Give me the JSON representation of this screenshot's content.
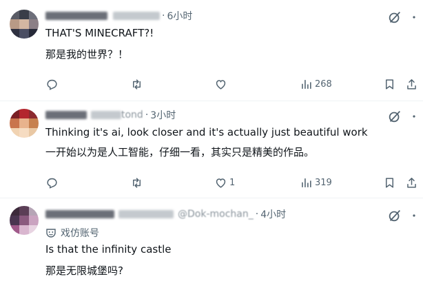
{
  "posts": [
    {
      "time": "6小时",
      "text": "THAT'S MINECRAFT?!",
      "translation": "那是我的世界？！",
      "stats": {
        "replies": "",
        "reposts": "",
        "likes": "",
        "views": "268"
      }
    },
    {
      "handle_visible": "tond",
      "time": "3小时",
      "text": "Thinking it's ai, look closer and it's actually just beautiful work",
      "translation": "一开始以为是人工智能，仔细一看，其实只是精美的作品。",
      "stats": {
        "replies": "",
        "reposts": "",
        "likes": "1",
        "views": "319"
      }
    },
    {
      "handle_visible": "@Dok-mochan_",
      "time": "4小时",
      "parody_label": "戏仿账号",
      "text": "Is that the infinity castle",
      "translation": "那是无限城堡吗?"
    }
  ],
  "icons": {
    "reply": "reply-bubble-icon",
    "repost": "repost-icon",
    "like": "heart-icon",
    "views": "views-chart-icon",
    "bookmark": "bookmark-icon",
    "share": "share-icon",
    "grok": "grok-icon",
    "more": "more-dots-icon",
    "parody": "parody-mask-icon"
  },
  "colors": {
    "text": "#0f1419",
    "muted": "#536471",
    "divider": "#eff3f4"
  }
}
